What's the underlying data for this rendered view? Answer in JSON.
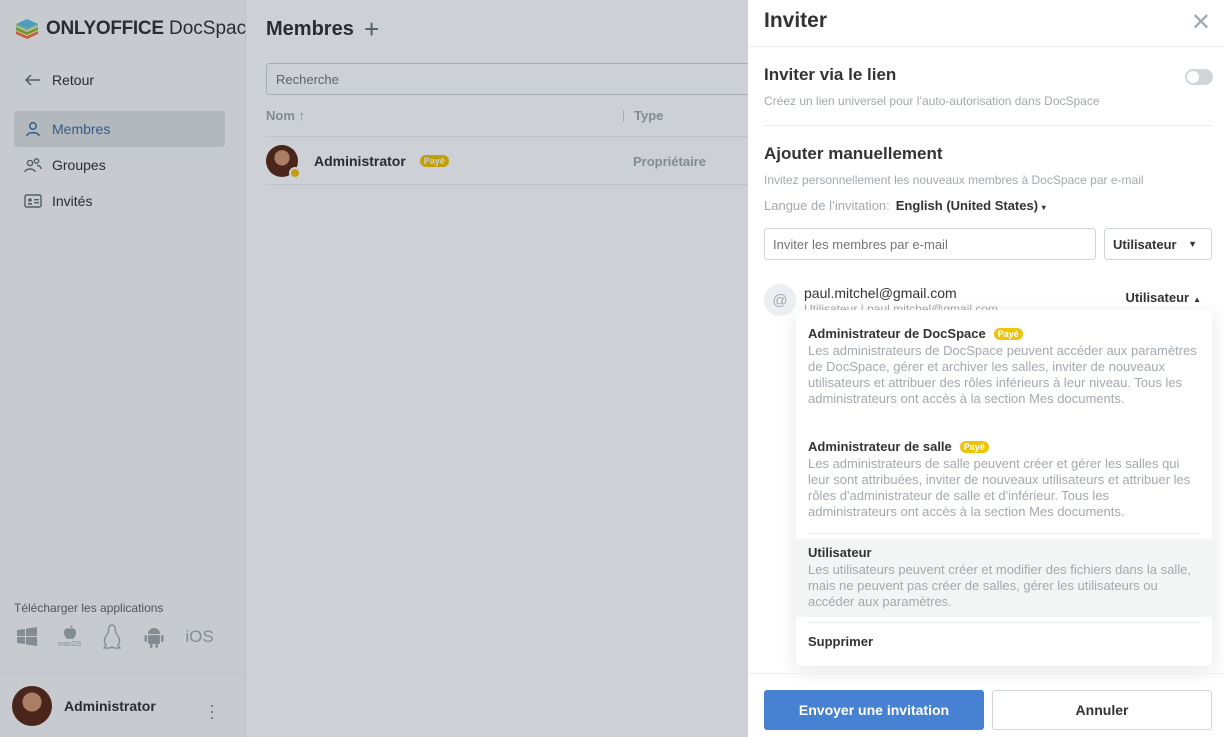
{
  "app": {
    "logo_bold": "ONLYOFFICE",
    "logo_light": "DocSpace"
  },
  "sidebar": {
    "back_label": "Retour",
    "items": [
      {
        "label": "Membres",
        "icon": "person-icon",
        "active": true
      },
      {
        "label": "Groupes",
        "icon": "group-icon",
        "active": false
      },
      {
        "label": "Invités",
        "icon": "guest-card-icon",
        "active": false
      }
    ],
    "download_title": "Télécharger les applications",
    "apps": [
      "windows",
      "macOS",
      "linux",
      "android",
      "iOS"
    ],
    "user_name": "Administrator"
  },
  "main": {
    "title": "Membres",
    "search_placeholder": "Recherche",
    "columns": {
      "name": "Nom",
      "type": "Type"
    },
    "rows": [
      {
        "name": "Administrator",
        "badge": "Payé",
        "type": "Propriétaire"
      }
    ]
  },
  "invite": {
    "title": "Inviter",
    "link_section_title": "Inviter via le lien",
    "link_section_desc": "Créez un lien universel pour l’auto-autorisation dans DocSpace",
    "manual_title": "Ajouter manuellement",
    "manual_desc": "Invitez personnellement les nouveaux membres à DocSpace par e-mail",
    "lang_label": "Langue de l’invitation:",
    "lang_value": "English (United States)",
    "email_placeholder": "Inviter les membres par e-mail",
    "role_default": "Utilisateur",
    "invitee": {
      "email": "paul.mitchel@gmail.com",
      "sub": "Utilisateur | paul.mitchel@gmail.com",
      "role": "Utilisateur"
    },
    "roles": [
      {
        "title": "Administrateur de DocSpace",
        "badge": "Payé",
        "desc": "Les administrateurs de DocSpace peuvent accéder aux paramètres de DocSpace, gérer et archiver les salles, inviter de nouveaux utilisateurs et attribuer des rôles inférieurs à leur niveau. Tous les administrateurs ont accès à la section Mes documents."
      },
      {
        "title": "Administrateur de salle",
        "badge": "Payé",
        "desc": "Les administrateurs de salle peuvent créer et gérer les salles qui leur sont attribuées, inviter de nouveaux utilisateurs et attribuer les rôles d'administrateur de salle et d'inférieur. Tous les administrateurs ont accès à la section Mes documents."
      },
      {
        "title": "Utilisateur",
        "desc": "Les utilisateurs peuvent créer et modifier des fichiers dans la salle, mais ne peuvent pas créer de salles, gérer les utilisateurs ou accéder aux paramètres."
      }
    ],
    "remove_label": "Supprimer",
    "send_label": "Envoyer une invitation",
    "cancel_label": "Annuler"
  },
  "colors": {
    "accent": "#4781d1",
    "paid_badge": "#edc409",
    "active_nav": "#3b72a7"
  }
}
